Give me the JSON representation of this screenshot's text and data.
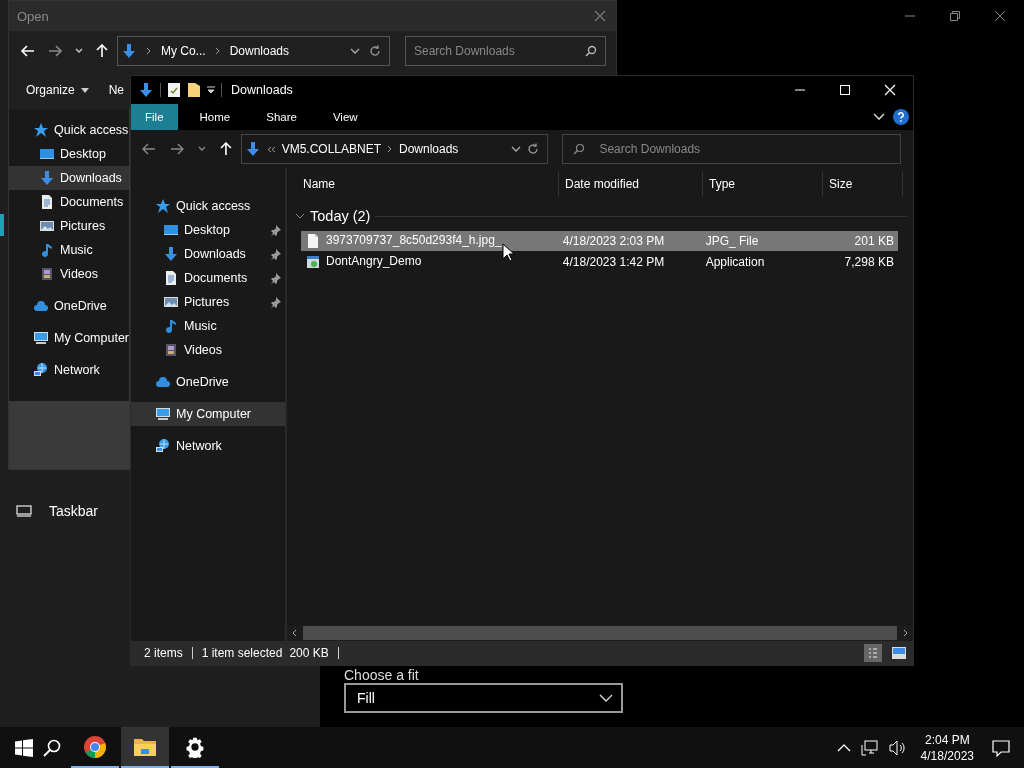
{
  "settings": {
    "sidebar_item": {
      "label": "Taskbar"
    },
    "fit": {
      "label": "Choose a fit",
      "value": "Fill"
    }
  },
  "open_dialog": {
    "title": "Open",
    "address": [
      "My Co...",
      "Downloads"
    ],
    "search": {
      "placeholder": "Search Downloads"
    },
    "toolbar": [
      {
        "label": "Organize",
        "menu": true
      },
      {
        "label": "Ne"
      }
    ],
    "nav": [
      {
        "label": "Quick access",
        "kind": "star",
        "selected": false,
        "children": [
          {
            "label": "Desktop",
            "kind": "desktop",
            "selected": false
          },
          {
            "label": "Downloads",
            "kind": "download",
            "selected": true
          },
          {
            "label": "Documents",
            "kind": "document",
            "selected": false
          },
          {
            "label": "Pictures",
            "kind": "picture",
            "selected": false
          },
          {
            "label": "Music",
            "kind": "music",
            "selected": false
          },
          {
            "label": "Videos",
            "kind": "video",
            "selected": false
          }
        ]
      },
      {
        "label": "OneDrive",
        "kind": "cloud",
        "selected": false
      },
      {
        "label": "My Computer",
        "kind": "computer",
        "selected": false
      },
      {
        "label": "Network",
        "kind": "network",
        "selected": false
      }
    ]
  },
  "explorer": {
    "title": "Downloads",
    "ribbon_tabs": [
      {
        "label": "File",
        "selected": true
      },
      {
        "label": "Home",
        "selected": false
      },
      {
        "label": "Share",
        "selected": false
      },
      {
        "label": "View",
        "selected": false
      }
    ],
    "address": [
      "VM5.COLLABNET",
      "Downloads"
    ],
    "search": {
      "placeholder": "Search Downloads"
    },
    "nav": [
      {
        "label": "Quick access",
        "kind": "star",
        "selected": false,
        "children": [
          {
            "label": "Desktop",
            "kind": "desktop",
            "selected": false,
            "pinned": true
          },
          {
            "label": "Downloads",
            "kind": "download",
            "selected": false,
            "pinned": true
          },
          {
            "label": "Documents",
            "kind": "document",
            "selected": false,
            "pinned": true
          },
          {
            "label": "Pictures",
            "kind": "picture",
            "selected": false,
            "pinned": true
          },
          {
            "label": "Music",
            "kind": "music",
            "selected": false,
            "pinned": false
          },
          {
            "label": "Videos",
            "kind": "video",
            "selected": false,
            "pinned": false
          }
        ]
      },
      {
        "label": "OneDrive",
        "kind": "cloud",
        "selected": false
      },
      {
        "label": "My Computer",
        "kind": "computer",
        "selected": true
      },
      {
        "label": "Network",
        "kind": "network",
        "selected": false
      }
    ],
    "columns": [
      "Name",
      "Date modified",
      "Type",
      "Size"
    ],
    "group": {
      "label": "Today (2)",
      "expanded": true
    },
    "rows": [
      {
        "name": "3973709737_8c50d293f4_h.jpg_",
        "date": "4/18/2023 2:03 PM",
        "type": "JPG_ File",
        "size": "201 KB",
        "kind": "file",
        "selected": true
      },
      {
        "name": "DontAngry_Demo",
        "date": "4/18/2023 1:42 PM",
        "type": "Application",
        "size": "7,298 KB",
        "kind": "app",
        "selected": false
      }
    ],
    "status": [
      "2 items",
      "1 item selected",
      "200 KB"
    ]
  },
  "taskbar": {
    "apps": [
      {
        "kind": "chrome",
        "active": false
      },
      {
        "kind": "folder",
        "active": true
      },
      {
        "kind": "gear",
        "active": false
      }
    ],
    "time": "2:04 PM",
    "date": "4/18/2023"
  }
}
